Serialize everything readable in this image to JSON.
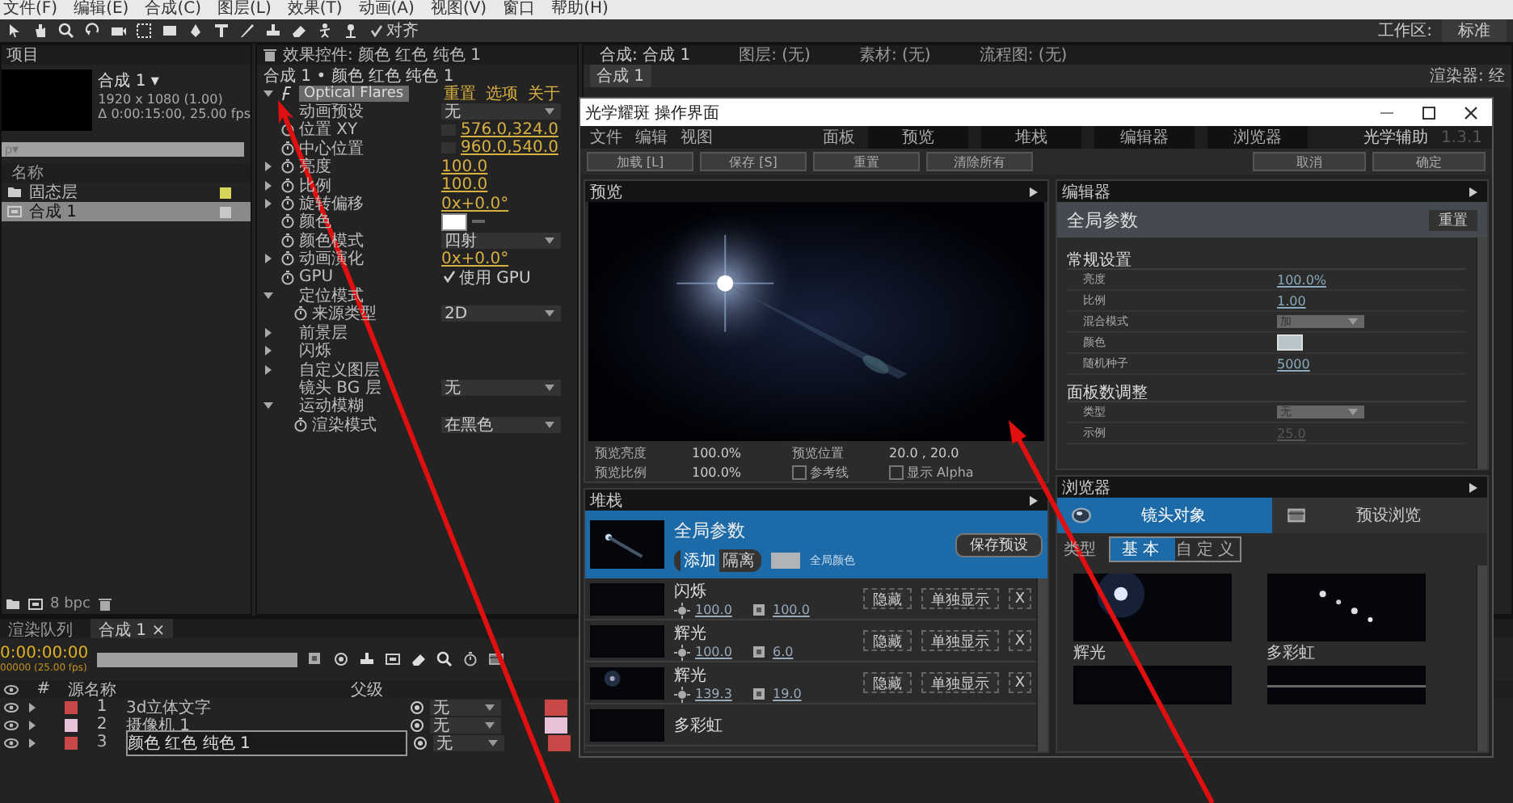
{
  "menu_bar": [
    "文件(F)",
    "编辑(E)",
    "合成(C)",
    "图层(L)",
    "效果(T)",
    "动画(A)",
    "视图(V)",
    "窗口",
    "帮助(H)"
  ],
  "toolbar": {
    "snap_label": "对齐",
    "snap_checked": true,
    "workspace_label": "工作区:",
    "workspace_value": "标准"
  },
  "project_panel": {
    "title": "项目",
    "comp_name": "合成 1 ▾",
    "comp_size": "1920 x 1080 (1.00)",
    "comp_duration": "Δ 0:00:15:00, 25.00 fps",
    "search_placeholder": "ρ▾",
    "column": "名称",
    "items": [
      {
        "name": "固态层",
        "kind": "folder",
        "color": "#d6d65a",
        "selected": false
      },
      {
        "name": "合成 1",
        "kind": "comp",
        "color": "#c8c8c8",
        "selected": true
      }
    ],
    "bit_depth": "8 bpc"
  },
  "effect_controls": {
    "tab": "效果控件: 颜色 红色 纯色 1",
    "breadcrumb": "合成 1 • 颜色 红色 纯色 1",
    "effect_name": "Optical Flares",
    "links": [
      "重置",
      "选项",
      "关于"
    ],
    "properties": [
      {
        "label": "动画预设",
        "kind": "dropdown",
        "value": "无",
        "animatable": false
      },
      {
        "label": "位置 XY",
        "kind": "point",
        "value": "576.0,324.0",
        "animatable": true
      },
      {
        "label": "中心位置",
        "kind": "point",
        "value": "960.0,540.0",
        "animatable": true
      },
      {
        "label": "亮度",
        "kind": "number",
        "value": "100.0",
        "animatable": true,
        "expanded": false
      },
      {
        "label": "比例",
        "kind": "number",
        "value": "100.0",
        "animatable": true,
        "expanded": false
      },
      {
        "label": "旋转偏移",
        "kind": "number",
        "value": "0x+0.0°",
        "animatable": true,
        "expanded": false
      },
      {
        "label": "颜色",
        "kind": "swatch",
        "color": "#ffffff",
        "animatable": true
      },
      {
        "label": "颜色模式",
        "kind": "dropdown",
        "value": "四射",
        "animatable": true
      },
      {
        "label": "动画演化",
        "kind": "number",
        "value": "0x+0.0°",
        "animatable": true,
        "expanded": false
      },
      {
        "label": "GPU",
        "kind": "check",
        "value": "使用 GPU",
        "checked": true,
        "animatable": true
      },
      {
        "label": "定位模式",
        "kind": "group",
        "expanded": true,
        "animatable": false,
        "children": [
          {
            "label": "来源类型",
            "kind": "dropdown",
            "value": "2D",
            "animatable": true
          }
        ]
      },
      {
        "label": "前景层",
        "kind": "group",
        "expanded": false,
        "animatable": false
      },
      {
        "label": "闪烁",
        "kind": "group",
        "expanded": false,
        "animatable": false
      },
      {
        "label": "自定义图层",
        "kind": "group",
        "expanded": false,
        "animatable": false
      },
      {
        "label": "镜头 BG 层",
        "kind": "dropdown",
        "value": "无",
        "animatable": false
      },
      {
        "label": "运动模糊",
        "kind": "group",
        "expanded": true,
        "animatable": false,
        "children": [
          {
            "label": "渲染模式",
            "kind": "dropdown",
            "value": "在黑色",
            "animatable": true
          }
        ]
      }
    ]
  },
  "comp_panel": {
    "tab": "合成: 合成 1",
    "viewer_tab": "合成 1",
    "layer": "图层: (无)",
    "footage": "素材: (无)",
    "flowchart": "流程图: (无)",
    "renderer": "渲染器: 经"
  },
  "timeline": {
    "tabs": [
      {
        "label": "渲染队列",
        "selected": false
      },
      {
        "label": "合成 1 ×",
        "selected": true
      }
    ],
    "timecode": "0:00:00:00",
    "frames": "00000 (25.00 fps)",
    "columns": [
      "#",
      "源名称",
      "父级"
    ],
    "layers": [
      {
        "number": "1",
        "name": "3d立体文字",
        "color": "#c84848",
        "parent": "无",
        "selected": false
      },
      {
        "number": "2",
        "name": "摄像机 1",
        "color": "#e8c0d8",
        "parent": "无",
        "selected": false
      },
      {
        "number": "3",
        "name": "颜色 红色 纯色 1",
        "color": "#c84848",
        "parent": "无",
        "selected": true
      }
    ]
  },
  "dialog": {
    "title": "光学耀斑 操作界面",
    "menu": [
      "文件",
      "编辑",
      "视图"
    ],
    "panels_label": "面板",
    "tabs": [
      "预览",
      "堆栈",
      "编辑器",
      "浏览器"
    ],
    "help": "光学辅助",
    "version": "1.3.1",
    "buttons": [
      "加载 [L]",
      "保存 [S]",
      "重置",
      "清除所有"
    ],
    "actions": [
      "取消",
      "确定"
    ],
    "preview": {
      "title": "预览",
      "fields": [
        {
          "label": "预览亮度",
          "value": "100.0%"
        },
        {
          "label": "预览位置",
          "value": "20.0 , 20.0"
        },
        {
          "label": "预览比例",
          "value": "100.0%"
        }
      ],
      "guides": {
        "label": "参考线",
        "checked": false
      },
      "alpha": {
        "label": "显示 Alpha",
        "checked": false
      }
    },
    "stack": {
      "title": "堆栈",
      "global": {
        "name": "全局参数",
        "add": "添加",
        "isolate": "隔离",
        "color_label": "全局颜色",
        "save": "保存预设",
        "selected": true
      },
      "elements": [
        {
          "name": "闪烁",
          "brightness": "100.0",
          "scale": "100.0",
          "hide": "隐藏",
          "solo": "单独显示",
          "remove": "X"
        },
        {
          "name": "辉光",
          "brightness": "100.0",
          "scale": "6.0",
          "hide": "隐藏",
          "solo": "单独显示",
          "remove": "X"
        },
        {
          "name": "辉光",
          "brightness": "139.3",
          "scale": "19.0",
          "hide": "隐藏",
          "solo": "单独显示",
          "remove": "X"
        },
        {
          "name": "多彩虹"
        }
      ]
    },
    "editor": {
      "title": "编辑器",
      "heading": "全局参数",
      "reset": "重置",
      "sections": [
        {
          "title": "常规设置",
          "rows": [
            {
              "label": "亮度",
              "kind": "text",
              "value": "100.0%"
            },
            {
              "label": "比例",
              "kind": "text",
              "value": "1.00"
            },
            {
              "label": "混合模式",
              "kind": "dropdown",
              "value": "加"
            },
            {
              "label": "颜色",
              "kind": "swatch",
              "color": "#b8c4c8"
            },
            {
              "label": "随机种子",
              "kind": "text",
              "value": "5000"
            }
          ]
        },
        {
          "title": "面板数调整",
          "rows": [
            {
              "label": "类型",
              "kind": "dropdown",
              "value": "无"
            },
            {
              "label": "示例",
              "kind": "text",
              "value": "25.0",
              "disabled": true
            }
          ]
        }
      ]
    },
    "browser": {
      "title": "浏览器",
      "tabs": [
        {
          "label": "镜头对象",
          "selected": true
        },
        {
          "label": "预设浏览",
          "selected": false
        }
      ],
      "type_label": "类型",
      "types": [
        {
          "label": "基本",
          "selected": true
        },
        {
          "label": "自定义",
          "selected": false
        }
      ],
      "items": [
        {
          "label": "辉光"
        },
        {
          "label": "多彩虹"
        },
        {
          "kind": "picture"
        },
        {
          "kind": "picture"
        }
      ]
    }
  }
}
